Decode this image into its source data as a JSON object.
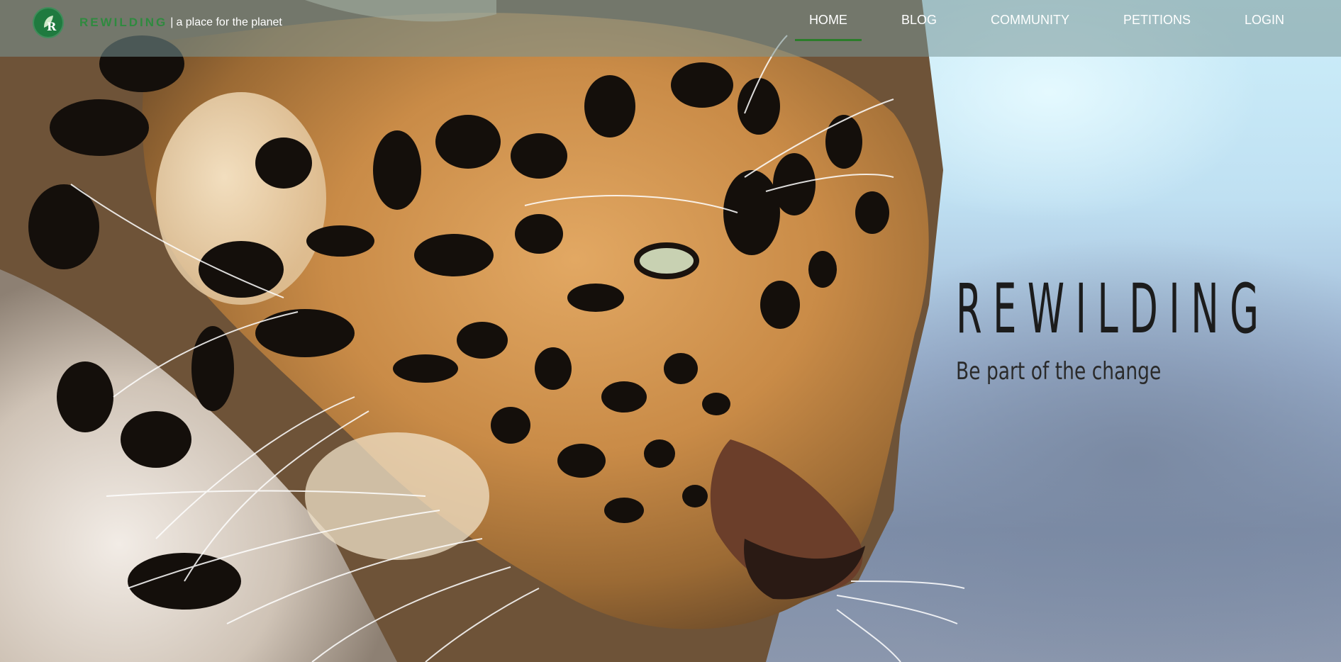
{
  "brand": {
    "name": "REWILDING",
    "separator": "|",
    "tagline": "a place for the planet",
    "logo_icon": "leaf-r-icon"
  },
  "nav": {
    "items": [
      {
        "label": "HOME",
        "active": true
      },
      {
        "label": "BLOG",
        "active": false
      },
      {
        "label": "COMMUNITY",
        "active": false
      },
      {
        "label": "PETITIONS",
        "active": false
      },
      {
        "label": "LOGIN",
        "active": false
      }
    ]
  },
  "hero": {
    "title": "REWILDING",
    "subtitle": "Be part of the change"
  },
  "colors": {
    "accent": "#2b7d2a",
    "logo_bg": "#1f7a3f"
  }
}
